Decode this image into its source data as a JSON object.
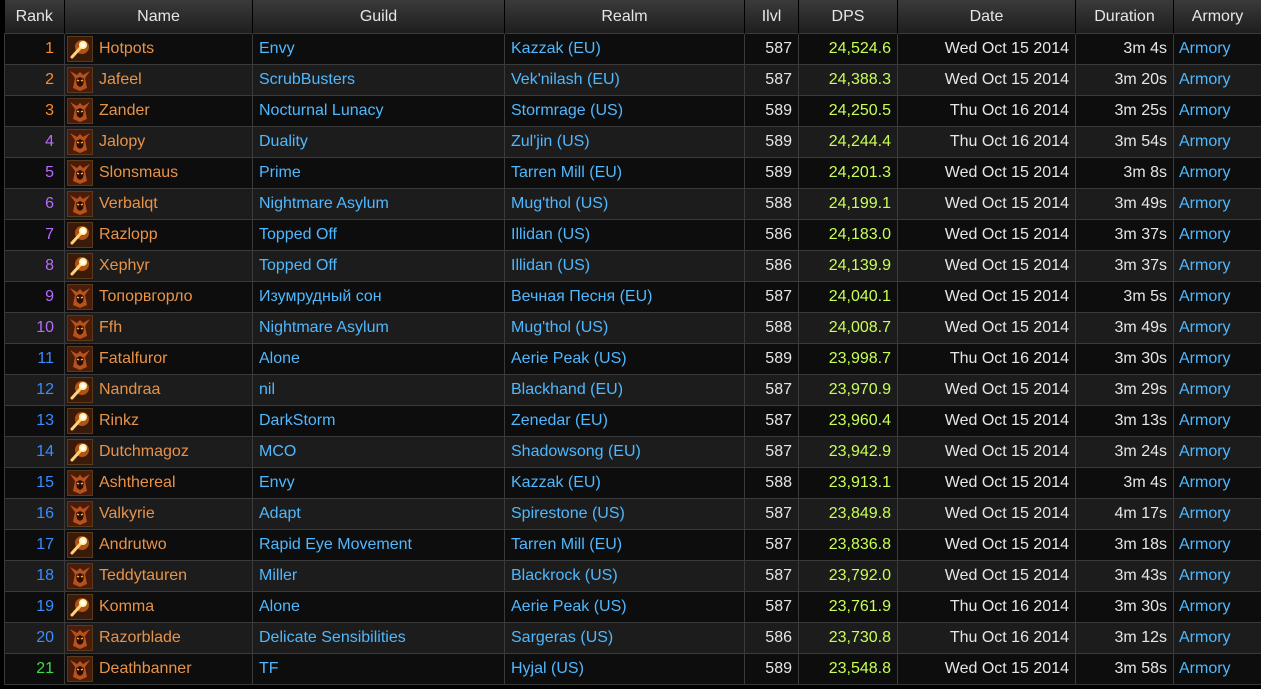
{
  "colors": {
    "name": "#e8934a",
    "guild": "#4fb8ff",
    "dps": "#c8ff54",
    "rank_tiers": {
      "orange": "#ff8a2a",
      "purple": "#b86bff",
      "blue": "#3a8cff",
      "green": "#3fdd3f"
    }
  },
  "header": {
    "rank": "Rank",
    "name": "Name",
    "guild": "Guild",
    "realm": "Realm",
    "ilvl": "Ilvl",
    "dps": "DPS",
    "date": "Date",
    "duration": "Duration",
    "armory": "Armory"
  },
  "rows": [
    {
      "rank": "1",
      "tier": "orange",
      "icon": "fire-mage-icon",
      "name": "Hotpots",
      "guild": "Envy",
      "realm": "Kazzak (EU)",
      "ilvl": "587",
      "dps": "24,524.6",
      "date": "Wed Oct 15 2014",
      "duration": "3m 4s",
      "armory": "Armory"
    },
    {
      "rank": "2",
      "tier": "orange",
      "icon": "warrior-helm-icon",
      "name": "Jafeel",
      "guild": "ScrubBusters",
      "realm": "Vek'nilash (EU)",
      "ilvl": "587",
      "dps": "24,388.3",
      "date": "Wed Oct 15 2014",
      "duration": "3m 20s",
      "armory": "Armory"
    },
    {
      "rank": "3",
      "tier": "orange",
      "icon": "warrior-helm-icon",
      "name": "Zander",
      "guild": "Nocturnal Lunacy",
      "realm": "Stormrage (US)",
      "ilvl": "589",
      "dps": "24,250.5",
      "date": "Thu Oct 16 2014",
      "duration": "3m 25s",
      "armory": "Armory"
    },
    {
      "rank": "4",
      "tier": "purple",
      "icon": "warrior-helm-icon",
      "name": "Jalopy",
      "guild": "Duality",
      "realm": "Zul'jin (US)",
      "ilvl": "589",
      "dps": "24,244.4",
      "date": "Thu Oct 16 2014",
      "duration": "3m 54s",
      "armory": "Armory"
    },
    {
      "rank": "5",
      "tier": "purple",
      "icon": "warrior-helm-icon",
      "name": "Slonsmaus",
      "guild": "Prime",
      "realm": "Tarren Mill (EU)",
      "ilvl": "589",
      "dps": "24,201.3",
      "date": "Wed Oct 15 2014",
      "duration": "3m 8s",
      "armory": "Armory"
    },
    {
      "rank": "6",
      "tier": "purple",
      "icon": "warrior-helm-icon",
      "name": "Verbalqt",
      "guild": "Nightmare Asylum",
      "realm": "Mug'thol (US)",
      "ilvl": "588",
      "dps": "24,199.1",
      "date": "Wed Oct 15 2014",
      "duration": "3m 49s",
      "armory": "Armory"
    },
    {
      "rank": "7",
      "tier": "purple",
      "icon": "fire-mage-icon",
      "name": "Razlopp",
      "guild": "Topped Off",
      "realm": "Illidan (US)",
      "ilvl": "586",
      "dps": "24,183.0",
      "date": "Wed Oct 15 2014",
      "duration": "3m 37s",
      "armory": "Armory"
    },
    {
      "rank": "8",
      "tier": "purple",
      "icon": "fire-mage-icon",
      "name": "Xephyr",
      "guild": "Topped Off",
      "realm": "Illidan (US)",
      "ilvl": "586",
      "dps": "24,139.9",
      "date": "Wed Oct 15 2014",
      "duration": "3m 37s",
      "armory": "Armory"
    },
    {
      "rank": "9",
      "tier": "purple",
      "icon": "warrior-helm-icon",
      "name": "Топорвгорло",
      "guild": "Изумрудный сон",
      "realm": "Вечная Песня (EU)",
      "ilvl": "587",
      "dps": "24,040.1",
      "date": "Wed Oct 15 2014",
      "duration": "3m 5s",
      "armory": "Armory"
    },
    {
      "rank": "10",
      "tier": "purple",
      "icon": "warrior-helm-icon",
      "name": "Ffh",
      "guild": "Nightmare Asylum",
      "realm": "Mug'thol (US)",
      "ilvl": "588",
      "dps": "24,008.7",
      "date": "Wed Oct 15 2014",
      "duration": "3m 49s",
      "armory": "Armory"
    },
    {
      "rank": "11",
      "tier": "blue",
      "icon": "warrior-helm-icon",
      "name": "Fatalfuror",
      "guild": "Alone",
      "realm": "Aerie Peak (US)",
      "ilvl": "589",
      "dps": "23,998.7",
      "date": "Thu Oct 16 2014",
      "duration": "3m 30s",
      "armory": "Armory"
    },
    {
      "rank": "12",
      "tier": "blue",
      "icon": "fire-mage-icon",
      "name": "Nandraa",
      "guild": "nil",
      "realm": "Blackhand (EU)",
      "ilvl": "587",
      "dps": "23,970.9",
      "date": "Wed Oct 15 2014",
      "duration": "3m 29s",
      "armory": "Armory"
    },
    {
      "rank": "13",
      "tier": "blue",
      "icon": "fire-mage-icon",
      "name": "Rinkz",
      "guild": "DarkStorm",
      "realm": "Zenedar (EU)",
      "ilvl": "587",
      "dps": "23,960.4",
      "date": "Wed Oct 15 2014",
      "duration": "3m 13s",
      "armory": "Armory"
    },
    {
      "rank": "14",
      "tier": "blue",
      "icon": "fire-mage-icon",
      "name": "Dutchmagoz",
      "guild": "MCO",
      "realm": "Shadowsong (EU)",
      "ilvl": "587",
      "dps": "23,942.9",
      "date": "Wed Oct 15 2014",
      "duration": "3m 24s",
      "armory": "Armory"
    },
    {
      "rank": "15",
      "tier": "blue",
      "icon": "warrior-helm-icon",
      "name": "Ashthereal",
      "guild": "Envy",
      "realm": "Kazzak (EU)",
      "ilvl": "588",
      "dps": "23,913.1",
      "date": "Wed Oct 15 2014",
      "duration": "3m 4s",
      "armory": "Armory"
    },
    {
      "rank": "16",
      "tier": "blue",
      "icon": "warrior-helm-icon",
      "name": "Valkyrie",
      "guild": "Adapt",
      "realm": "Spirestone (US)",
      "ilvl": "587",
      "dps": "23,849.8",
      "date": "Wed Oct 15 2014",
      "duration": "4m 17s",
      "armory": "Armory"
    },
    {
      "rank": "17",
      "tier": "blue",
      "icon": "fire-mage-icon",
      "name": "Andrutwo",
      "guild": "Rapid Eye Movement",
      "realm": "Tarren Mill (EU)",
      "ilvl": "587",
      "dps": "23,836.8",
      "date": "Wed Oct 15 2014",
      "duration": "3m 18s",
      "armory": "Armory"
    },
    {
      "rank": "18",
      "tier": "blue",
      "icon": "warrior-helm-icon",
      "name": "Teddytauren",
      "guild": "Miller",
      "realm": "Blackrock (US)",
      "ilvl": "587",
      "dps": "23,792.0",
      "date": "Wed Oct 15 2014",
      "duration": "3m 43s",
      "armory": "Armory"
    },
    {
      "rank": "19",
      "tier": "blue",
      "icon": "fire-mage-icon",
      "name": "Komma",
      "guild": "Alone",
      "realm": "Aerie Peak (US)",
      "ilvl": "587",
      "dps": "23,761.9",
      "date": "Thu Oct 16 2014",
      "duration": "3m 30s",
      "armory": "Armory"
    },
    {
      "rank": "20",
      "tier": "blue",
      "icon": "warrior-helm-icon",
      "name": "Razorblade",
      "guild": "Delicate Sensibilities",
      "realm": "Sargeras (US)",
      "ilvl": "586",
      "dps": "23,730.8",
      "date": "Thu Oct 16 2014",
      "duration": "3m 12s",
      "armory": "Armory"
    },
    {
      "rank": "21",
      "tier": "green",
      "icon": "warrior-helm-icon",
      "name": "Deathbanner",
      "guild": "TF",
      "realm": "Hyjal (US)",
      "ilvl": "589",
      "dps": "23,548.8",
      "date": "Wed Oct 15 2014",
      "duration": "3m 58s",
      "armory": "Armory"
    }
  ]
}
